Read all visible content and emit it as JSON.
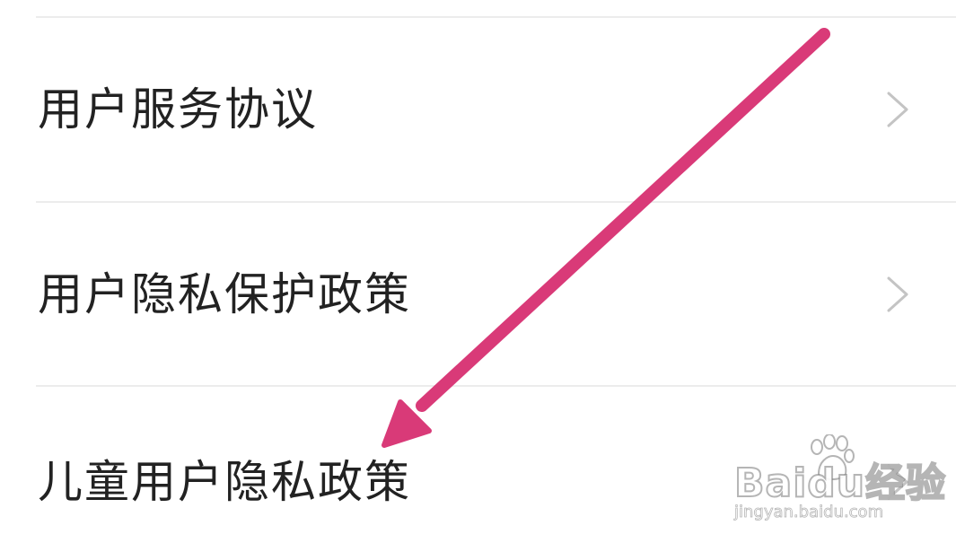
{
  "settings_list": {
    "items": [
      {
        "label": "用户服务协议",
        "icon": "chevron-right-icon"
      },
      {
        "label": "用户隐私保护政策",
        "icon": "chevron-right-icon"
      },
      {
        "label": "儿童用户隐私政策",
        "icon": "chevron-right-icon"
      }
    ]
  },
  "annotation": {
    "arrow_color": "#d93a78",
    "icon": "annotation-arrow"
  },
  "watermark": {
    "brand": "Baidu经验",
    "url": "jingyan.baidu.com",
    "icon": "baidu-paw-icon"
  },
  "colors": {
    "text": "#222222",
    "divider": "#ececec",
    "chevron": "#c4c4c4",
    "background": "#ffffff"
  }
}
